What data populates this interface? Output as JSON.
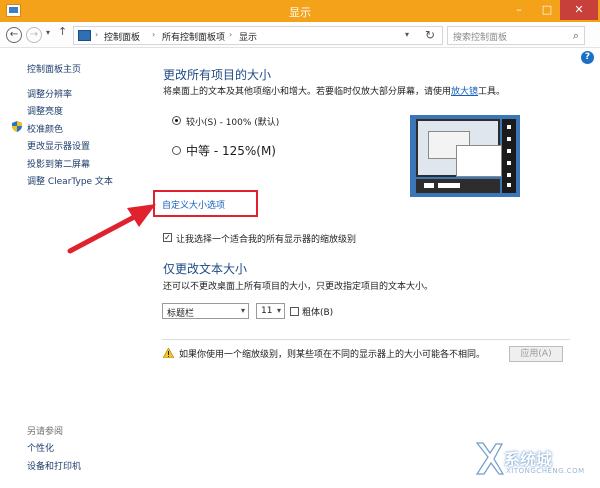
{
  "window": {
    "title": "显示",
    "minimize_glyph": "–",
    "maximize_glyph": "□",
    "close_glyph": "✕"
  },
  "address_bar": {
    "back_glyph": "←",
    "forward_glyph": "→",
    "up_glyph": "↑",
    "breadcrumbs": [
      "控制面板",
      "所有控制面板项",
      "显示"
    ],
    "separator": "›",
    "refresh_glyph": "↻",
    "search_placeholder": "搜索控制面板"
  },
  "help_glyph": "?",
  "sidebar": {
    "home": "控制面板主页",
    "items": [
      "调整分辨率",
      "调整亮度",
      "校准颜色",
      "更改显示器设置",
      "投影到第二屏幕",
      "调整 ClearType 文本"
    ],
    "see_also_title": "另请参阅",
    "see_also": [
      "个性化",
      "设备和打印机"
    ]
  },
  "main": {
    "heading": "更改所有项目的大小",
    "description_prefix": "将桌面上的文本及其他项缩小和增大。若要临时仅放大部分屏幕，请使用",
    "magnifier_link": "放大镜",
    "description_suffix": "工具。",
    "options": [
      {
        "label": "较小(S) - 100% (默认)",
        "selected": true
      },
      {
        "label": "中等 - 125%(M)",
        "selected": false
      }
    ],
    "custom_link": "自定义大小选项",
    "scaling_checkbox": {
      "label": "让我选择一个适合我的所有显示器的缩放级别",
      "checked": true
    }
  },
  "text_section": {
    "heading": "仅更改文本大小",
    "description": "还可以不更改桌面上所有项目的大小，只更改指定项目的文本大小。",
    "item_select": "标题栏",
    "size_select": "11",
    "bold_label": "粗体(B)",
    "bold_checked": false
  },
  "warning": {
    "text": "如果你使用一个缩放级别，则某些项在不同的显示器上的大小可能各不相同。",
    "apply_button": "应用(A)"
  },
  "watermark": {
    "brand": "系统城",
    "url": "XITONGCHENG.COM"
  },
  "colors": {
    "title_bar": "#f4a21a",
    "close_button": "#c7403a",
    "heading": "#1f4b86",
    "link": "#1560bd",
    "highlight": "#e0222e"
  }
}
